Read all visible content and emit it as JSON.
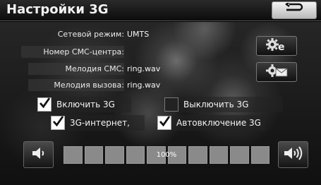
{
  "header": {
    "title": "Настройки 3G",
    "back_icon": "return-arrow-icon"
  },
  "fields": [
    {
      "label": "Сетевой режим:",
      "value": "UMTS"
    },
    {
      "label": "Номер СМС-центра:",
      "value": ""
    },
    {
      "label": "Мелодия СМС:",
      "value": "ring.wav"
    },
    {
      "label": "Мелодия вызова:",
      "value": "ring.wav"
    }
  ],
  "side_buttons": {
    "settings_icon": "gear-e-icon",
    "sms_settings_icon": "gear-envelope-icon"
  },
  "toggles": {
    "enable_3g": {
      "label": "Включить 3G",
      "checked": true
    },
    "disable_3g": {
      "label": "Выключить 3G",
      "checked": false
    },
    "internet_3g": {
      "label": "3G-интернет,",
      "checked": true
    },
    "auto_enable": {
      "label": "Автовключение 3G",
      "checked": true
    }
  },
  "volume": {
    "level_label": "100%",
    "level": 1.0,
    "segments": 10,
    "down_icon": "speaker-low-icon",
    "up_icon": "speaker-high-icon"
  }
}
